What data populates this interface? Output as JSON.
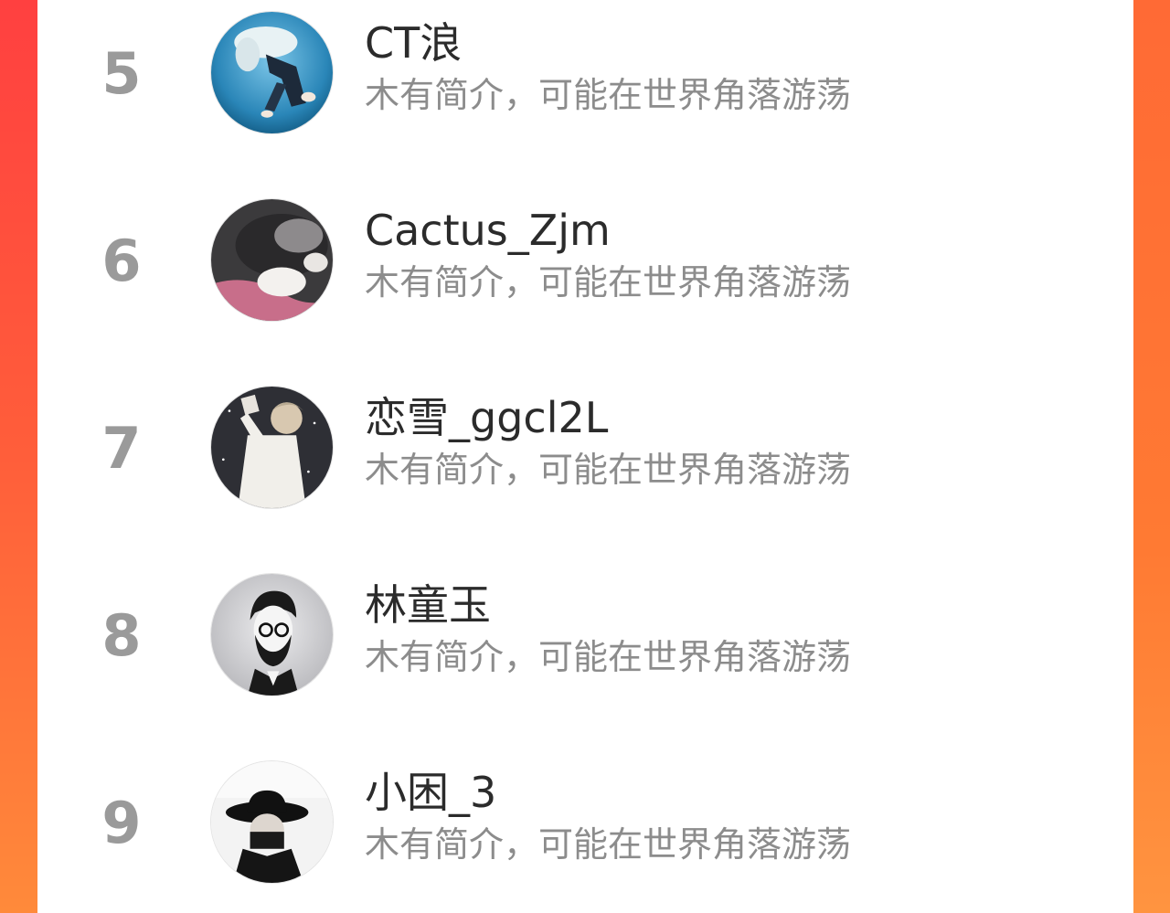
{
  "colors": {
    "background_gradient": [
      "#ff4040",
      "#ff8a3a"
    ],
    "card": "#ffffff",
    "rank": "#9a9a9a",
    "name": "#2b2b2b",
    "bio": "#8c8c8c"
  },
  "ranking": {
    "items": [
      {
        "rank": "5",
        "name": "CT浪",
        "bio": "木有简介，可能在世界角落游荡",
        "avatar_icon": "underwater-figure-avatar"
      },
      {
        "rank": "6",
        "name": "Cactus_Zjm",
        "bio": "木有简介，可能在世界角落游荡",
        "avatar_icon": "sleeping-cat-avatar"
      },
      {
        "rank": "7",
        "name": "恋雪_ggcl2L",
        "bio": "木有简介，可能在世界角落游荡",
        "avatar_icon": "anime-boy-avatar"
      },
      {
        "rank": "8",
        "name": "林童玉",
        "bio": "木有简介，可能在世界角落游荡",
        "avatar_icon": "bearded-man-avatar"
      },
      {
        "rank": "9",
        "name": "小困_3",
        "bio": "木有简介，可能在世界角落游荡",
        "avatar_icon": "hat-person-avatar"
      }
    ]
  }
}
